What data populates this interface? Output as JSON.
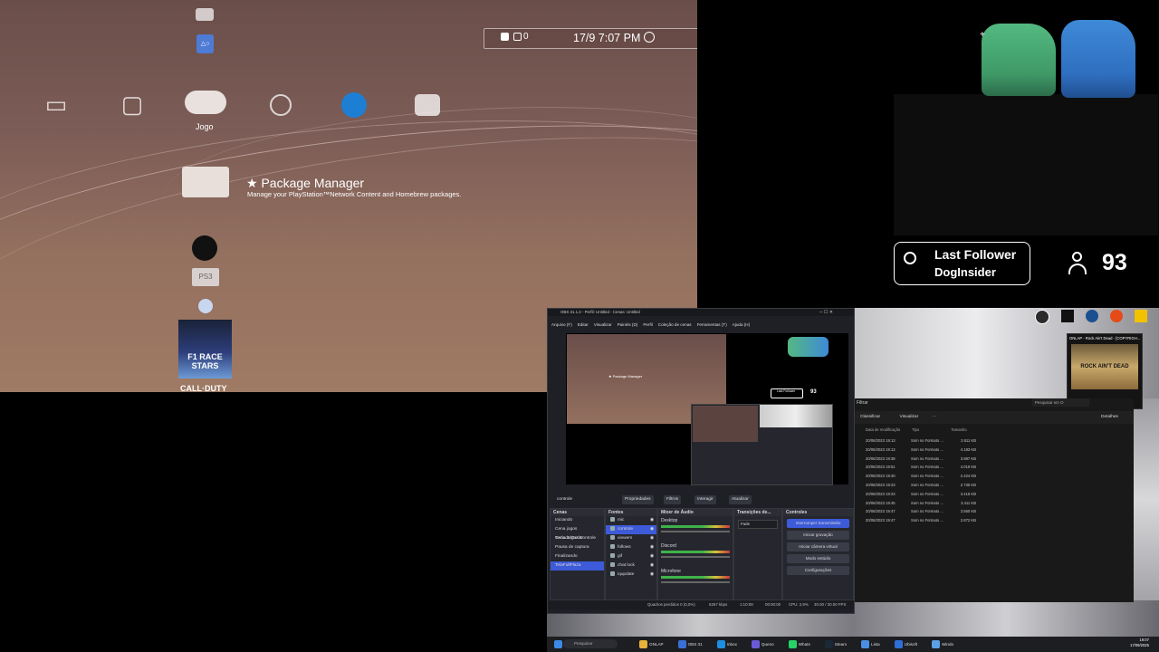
{
  "ps3": {
    "status": {
      "notif_count": "0",
      "datetime": "17/9 7:07 PM"
    },
    "categories": [
      {
        "name": "video-category-icon"
      },
      {
        "name": "tv-category-icon"
      },
      {
        "name": "game-category-icon",
        "label": "Jogo"
      },
      {
        "name": "network-category-icon"
      },
      {
        "name": "psn-category-icon"
      },
      {
        "name": "friends-category-icon"
      }
    ],
    "selected_item": {
      "title": "★ Package Manager",
      "description": "Manage your PlayStation™Network Content and Homebrew packages."
    },
    "game_items": [
      "F1 RACE STARS",
      "CALL·DUTY"
    ],
    "small_icon_label": "PS3"
  },
  "stream_overlay": {
    "last_follower_label": "Last Follower",
    "last_follower_name": "DogInsider",
    "viewer_count": "93"
  },
  "obs": {
    "title": "OBS 31.1.2 - Perfil: Untitled - Cenas: Untitled",
    "menu": [
      "Arquivo (F)",
      "Editar",
      "Visualizar",
      "Painéis (D)",
      "Perfil",
      "Coleção de cenas",
      "Ferramentas (T)",
      "Ajuda (H)"
    ],
    "source_bar": {
      "scene_label": "controle",
      "buttons": [
        "Propriedades",
        "Filtros",
        "Interagir",
        "Atualizar"
      ]
    },
    "docks": {
      "scenes": {
        "title": "Cenas",
        "items": [
          "Iniciando",
          "Cena jogos Teclado/Outlar",
          "Cena Jogos Controle",
          "Pausa de captura",
          "Finalizando",
          "TelaFullPlaza"
        ],
        "selected_index": 5
      },
      "sources": {
        "title": "Fontes",
        "items": [
          "mic",
          "controle",
          "viewers",
          "follows",
          "gif",
          "chat lock",
          "iqupdate"
        ]
      },
      "mixer": {
        "title": "Mixer de Áudio",
        "channels": [
          "Desktop",
          "Discord",
          "Microfone"
        ]
      },
      "transitions": {
        "title": "Transições de...",
        "value": "Fade"
      },
      "controls": {
        "title": "Controles",
        "buttons": [
          "Interromper transmissão",
          "Iniciar gravação",
          "Iniciar câmera virtual",
          "Modo estúdio",
          "Configurações"
        ]
      }
    },
    "statusbar": {
      "dropped": "Quadros perdidos 0 (0,0%)",
      "bitrate": "5267 kbps",
      "time": "1:10:08",
      "rec": "00:00:00",
      "cpu": "CPU: 2,9%",
      "fps": "30.00 / 30.00 FPS"
    }
  },
  "explorer": {
    "filter_label": "Filtrar",
    "search_placeholder": "Pesquisar em O",
    "toolbar": [
      "Classificar",
      "Visualizar",
      "···"
    ],
    "details_label": "Detalhes",
    "columns": [
      "Data de modificação",
      "Tipo",
      "Tamanho"
    ],
    "rows": [
      [
        "20/06/2023 19:13",
        "Som no Formato ...",
        "2.611 KB"
      ],
      [
        "20/06/2023 19:13",
        "Som no Formato ...",
        "4.183 KB"
      ],
      [
        "20/06/2023 19:38",
        "Som no Formato ...",
        "3.987 KB"
      ],
      [
        "20/06/2023 19:51",
        "Som no Formato ...",
        "4.019 KB"
      ],
      [
        "20/06/2023 19:40",
        "Som no Formato ...",
        "2.424 KB"
      ],
      [
        "20/06/2023 19:23",
        "Som no Formato ...",
        "2.735 KB"
      ],
      [
        "20/06/2023 19:23",
        "Som no Formato ...",
        "3.415 KB"
      ],
      [
        "20/06/2023 19:45",
        "Som no Formato ...",
        "3.411 KB"
      ],
      [
        "20/06/2023 19:47",
        "Som no Formato ...",
        "3.560 KB"
      ],
      [
        "20/06/2023 19:47",
        "Som no Formato ...",
        "2.872 KB"
      ]
    ]
  },
  "media_popup": {
    "title": "ONLAP - Rock Ain't Dead - [COPYRIGH...",
    "art_text": "ROCK AIN'T DEAD"
  },
  "taskbar": {
    "search_placeholder": "Pesquisar",
    "apps": [
      "ONLAP",
      "OBS 31",
      "Inbox",
      "Queno",
      "Whats",
      "Steam",
      "Lista",
      "Ubisoft",
      "Windo"
    ],
    "time": "19:07",
    "date": "17/09/2025"
  },
  "colors": {
    "obs_accent": "#3d5bd8",
    "obs_bg": "#1f2026",
    "xmb_bg": "#7d5d57"
  }
}
